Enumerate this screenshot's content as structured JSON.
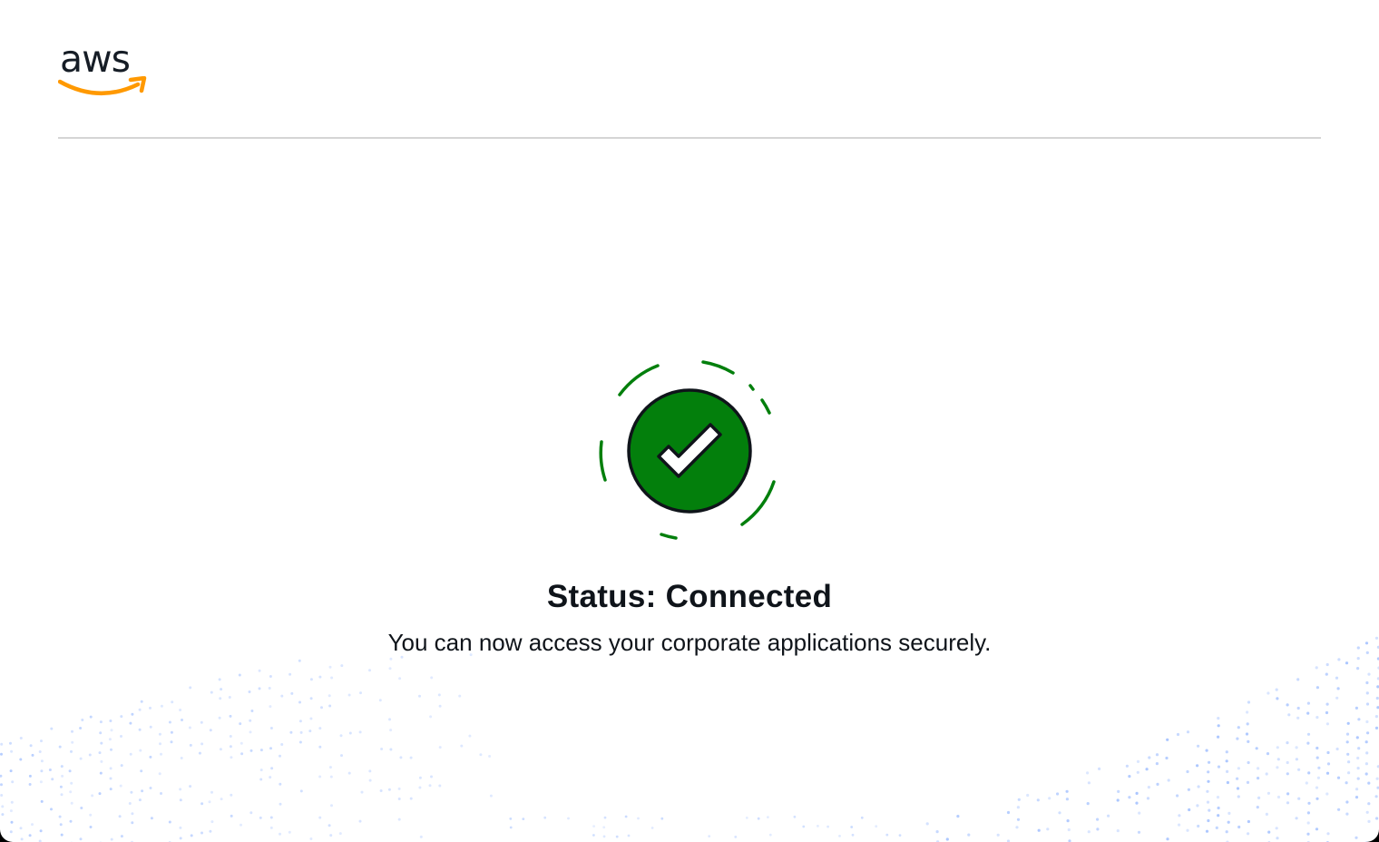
{
  "header": {
    "logo_text": "aws",
    "logo_icon": "aws-logo-icon"
  },
  "status": {
    "icon": "check-circle-icon",
    "title": "Status: Connected",
    "message": "You can now access your corporate applications securely."
  },
  "colors": {
    "success_green": "#037f0c",
    "logo_text": "#161d26",
    "logo_smile": "#ff9900",
    "text": "#0f141a",
    "divider": "#d5d5d5",
    "dots": "#8fb3ff"
  }
}
